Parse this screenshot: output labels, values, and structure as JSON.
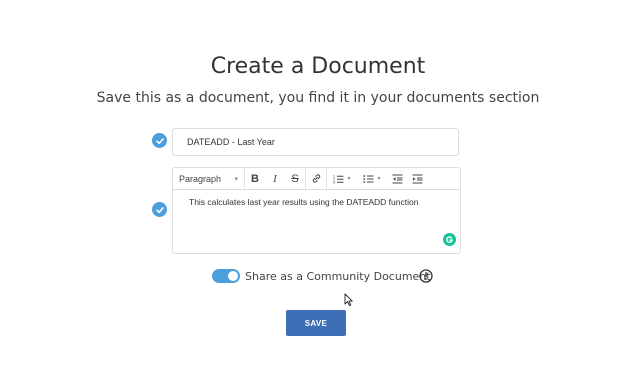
{
  "page": {
    "title": "Create a Document",
    "subtitle": "Save this as a document, you find it in your documents section"
  },
  "form": {
    "title_value": "DATEADD - Last Year",
    "editor": {
      "format_select": "Paragraph",
      "body_text": "This calculates last year results using the DATEADD function"
    },
    "share_toggle": {
      "on": true,
      "label": "Share as a Community Document"
    },
    "save_label": "SAVE"
  },
  "icons": {
    "check": "check-circle-icon",
    "bold": "bold-icon",
    "italic": "italic-icon",
    "strike": "strikethrough-icon",
    "link": "link-icon",
    "ordered_list": "ordered-list-icon",
    "bullet_list": "bullet-list-icon",
    "indent": "indent-icon",
    "outdent": "outdent-icon",
    "grammarly": "grammarly-icon",
    "info": "info-icon"
  },
  "colors": {
    "accent": "#4d9fdb",
    "save_button": "#3d6fb6",
    "grammarly": "#15c39a"
  }
}
